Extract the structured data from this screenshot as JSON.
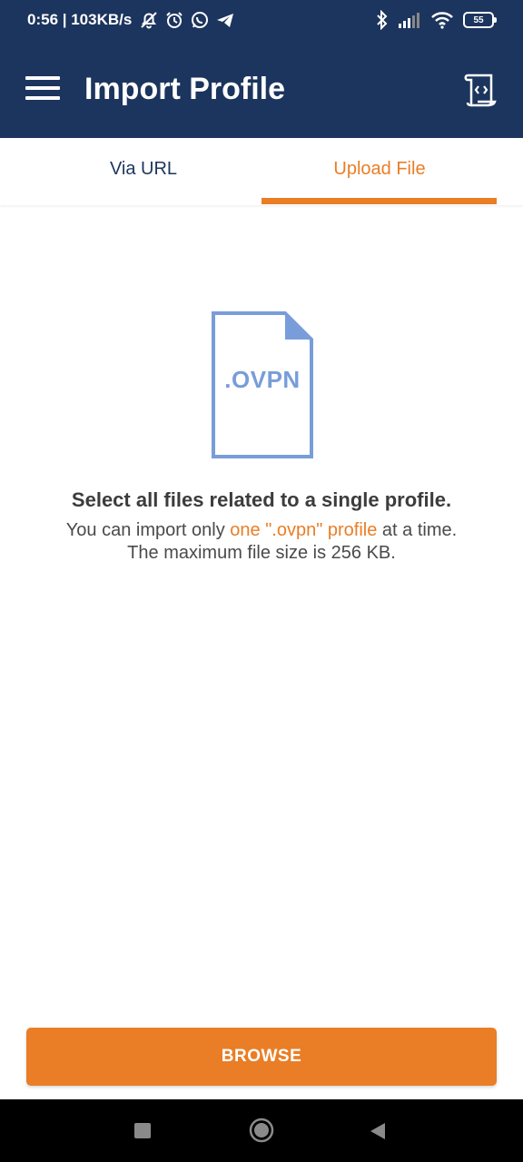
{
  "status_bar": {
    "time_and_speed": "0:56 | 103KB/s",
    "battery_level": "55",
    "icons_left": [
      "muted-alarm-icon",
      "alarm-clock-icon",
      "whatsapp-icon",
      "telegram-icon"
    ],
    "icons_right": [
      "bluetooth-icon",
      "signal-icon",
      "wifi-icon",
      "battery-icon"
    ]
  },
  "app_bar": {
    "title": "Import Profile",
    "menu_icon": "hamburger-menu-icon",
    "action_icon": "code-document-icon"
  },
  "tabs": [
    {
      "label": "Via URL",
      "selected": false
    },
    {
      "label": "Upload File",
      "selected": true
    }
  ],
  "main": {
    "file_icon_label": ".OVPN",
    "headline": "Select all files related to a single profile.",
    "info_prefix": "You can import only ",
    "info_highlight": "one \".ovpn\" profile",
    "info_suffix": " at a time.",
    "info_line2": "The maximum file size is 256 KB."
  },
  "browse_button": {
    "label": "BROWSE"
  },
  "colors": {
    "header_bg": "#1c355e",
    "accent": "#e97e26",
    "file_icon": "#789dd9",
    "text_dark": "#3c3c3c"
  },
  "nav_bar": {
    "icons": [
      "recent-apps-icon",
      "home-icon",
      "back-icon"
    ]
  }
}
